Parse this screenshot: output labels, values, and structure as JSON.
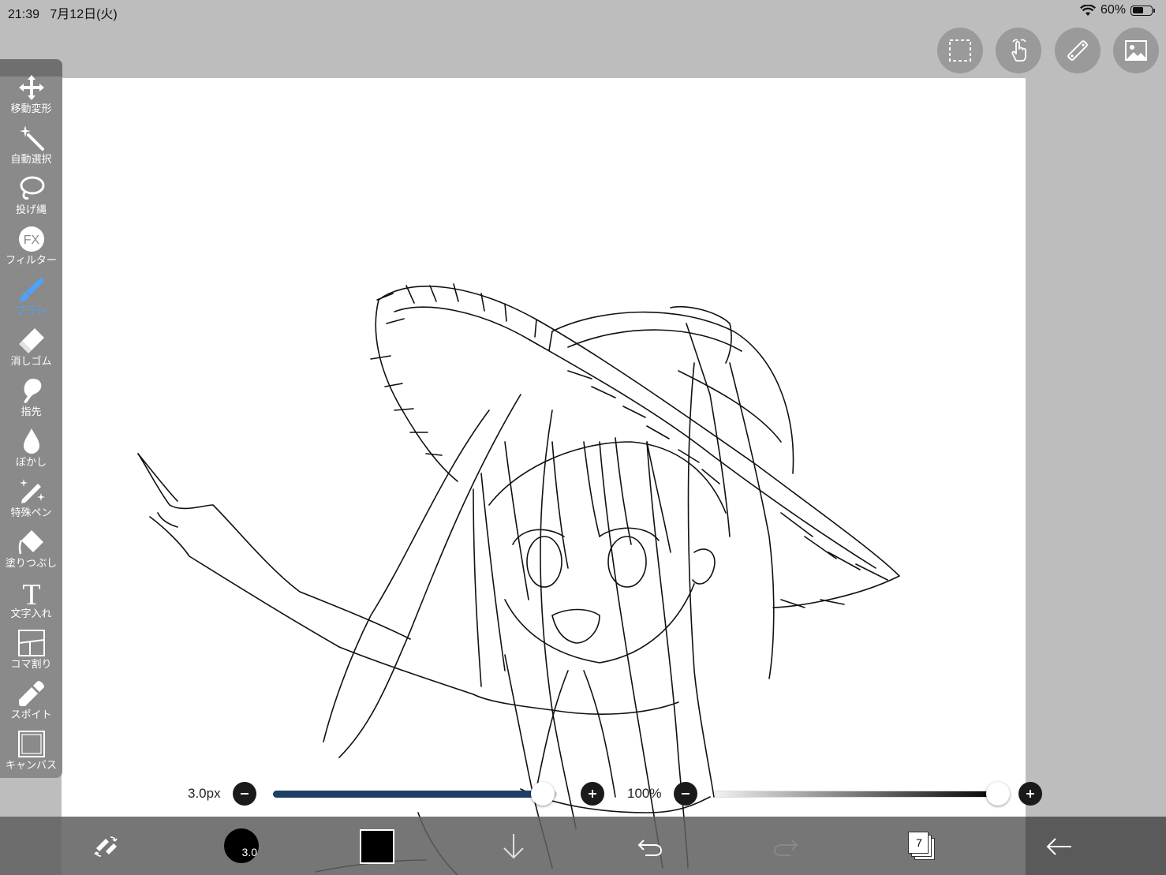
{
  "status_bar": {
    "time": "21:39",
    "date": "7月12日(火)",
    "battery_percent": "60%",
    "battery_level": 0.6
  },
  "top_buttons": [
    "selection-icon",
    "gesture-hand-icon",
    "ruler-icon",
    "image-material-icon"
  ],
  "toolbar": {
    "tools": [
      {
        "id": "move",
        "label": "移動変形",
        "icon": "move-arrows-icon",
        "active": false
      },
      {
        "id": "magic",
        "label": "自動選択",
        "icon": "magic-wand-icon",
        "active": false
      },
      {
        "id": "lasso",
        "label": "投げ縄",
        "icon": "lasso-icon",
        "active": false
      },
      {
        "id": "filter",
        "label": "フィルター",
        "icon": "fx-icon",
        "active": false
      },
      {
        "id": "brush",
        "label": "ブラシ",
        "icon": "brush-icon",
        "active": true
      },
      {
        "id": "eraser",
        "label": "消しゴム",
        "icon": "eraser-icon",
        "active": false
      },
      {
        "id": "finger",
        "label": "指先",
        "icon": "finger-smudge-icon",
        "active": false
      },
      {
        "id": "blur",
        "label": "ぼかし",
        "icon": "drop-icon",
        "active": false
      },
      {
        "id": "special",
        "label": "特殊ペン",
        "icon": "sparkle-pen-icon",
        "active": false
      },
      {
        "id": "fill",
        "label": "塗りつぶし",
        "icon": "bucket-icon",
        "active": false
      },
      {
        "id": "text",
        "label": "文字入れ",
        "icon": "text-t-icon",
        "active": false
      },
      {
        "id": "frame",
        "label": "コマ割り",
        "icon": "frame-divider-icon",
        "active": false
      },
      {
        "id": "eyedropper",
        "label": "スポイト",
        "icon": "eyedropper-icon",
        "active": false
      },
      {
        "id": "canvas",
        "label": "キャンバス",
        "icon": "canvas-icon",
        "active": false
      }
    ]
  },
  "sliders": {
    "size": {
      "label": "3.0px",
      "value": 0.95
    },
    "opacity": {
      "label": "100%",
      "value": 1.0
    }
  },
  "bottom_bar": {
    "brush_size_label": "3.0",
    "layer_count": "7",
    "color": "#000000",
    "icons": [
      "swap-tool-icon",
      "brush-size-icon",
      "color-swatch",
      "download-icon",
      "undo-icon",
      "redo-icon",
      "layers-icon",
      "back-arrow-icon"
    ]
  },
  "colors": {
    "toolbar_bg": "#8a8a8a",
    "active_tool": "#4aa3ff",
    "size_track": "#1f3f66",
    "canvas_bg": "#ffffff"
  }
}
